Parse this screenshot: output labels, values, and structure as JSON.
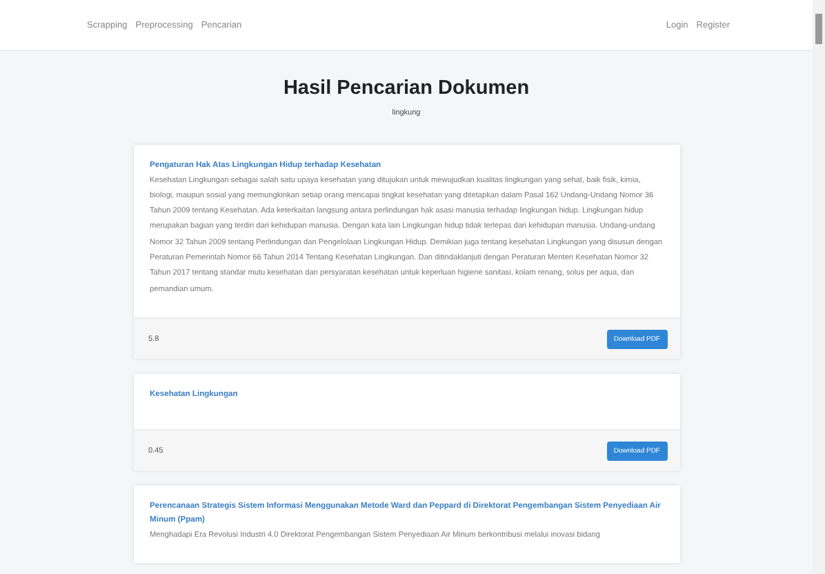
{
  "nav": {
    "left_links": [
      "Scrapping",
      "Preprocessing",
      "Pencarian"
    ],
    "right_links": [
      "Login",
      "Register"
    ]
  },
  "header": {
    "title": "Hasil Pencarian Dokumen",
    "query": "lingkung"
  },
  "results": [
    {
      "title": "Pengaturan Hak Atas Lingkungan Hidup terhadap Kesehatan",
      "snippet": "Kesehatan Lingkungan sebagai salah satu upaya kesehatan yang ditujukan untuk mewujudkan kualitas lingkungan yang sehat, baik fisik, kimia, biologi, maupun sosial yang memungkinkan setiap orang mencapai tingkat kesehatan yang ditetapkan dalam Pasal 162 Undang-Undang Nomor 36 Tahun 2009 tentang Kesehatan. Ada keterkaitan langsung antara perlindungan hak asasi manusia terhadap lingkungan hidup. Lingkungan hidup merupakan bagian yang terdiri dari kehidupan manusia. Dengan kata lain Lingkungan hidup tidak terlepas dari kehidupan manusia. Undang-undang Nomor 32 Tahun 2009 tentang Perlindungan dan Pengelolaan Lingkungan Hidup. Demikian juga tentang kesehatan Lingkungan yang disusun dengan Peraturan Pemerintah Nomor 66 Tahun 2014 Tentang Kesehatan Lingkungan. Dan ditindaklanjuti dengan Peraturan Menteri Kesehatan Nomor 32 Tahun 2017 tentang standar mutu kesehatan dan persyaratan kesehatan untuk keperluan higiene sanitasi, kolam renang, solus per aqua, dan pemandian umum.",
      "score": "5.8",
      "button": "Download PDF"
    },
    {
      "title": "Kesehatan Lingkungan",
      "score": "0.45",
      "button": "Download PDF"
    },
    {
      "title": "Perencanaan Strategis Sistem Informasi Menggunakan Metode Ward dan Peppard di Direktorat Pengembangan Sistem Penyediaan Air Minum (Ppam)",
      "snippet": "Menghadapi Era Revolusi Industri 4.0 Direktorat Pengembangan Sistem Penyediaan Air Minum berkontribusi melalui inovasi bidang"
    }
  ]
}
